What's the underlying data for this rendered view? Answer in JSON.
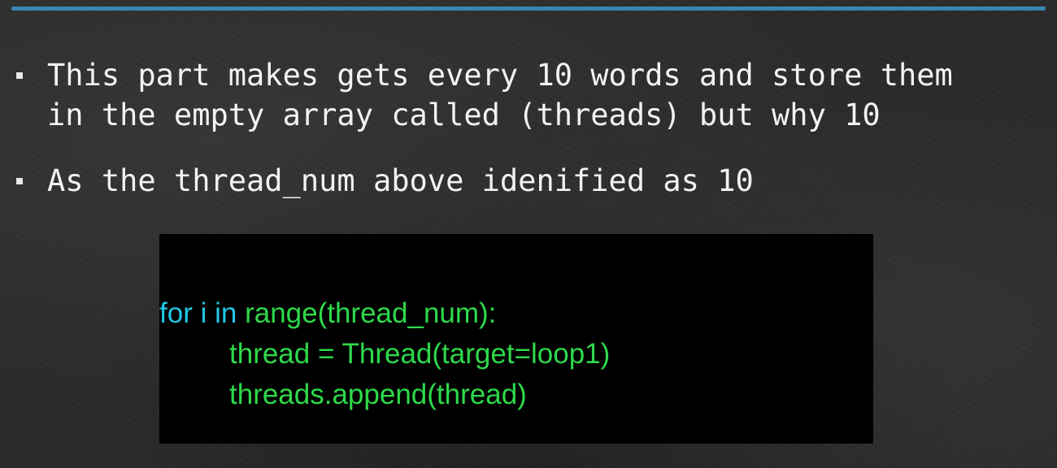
{
  "bullets": [
    {
      "lines": [
        "This part makes gets every 10 words and store them",
        "in the empty array called (threads) but why 10"
      ]
    },
    {
      "lines": [
        "As the thread_num above idenified as 10"
      ]
    }
  ],
  "code": {
    "line1": {
      "kw_for": "for",
      "var_i": " i ",
      "kw_in": "in",
      "rest": " range(thread_num):"
    },
    "line2": "thread = Thread(target=loop1)",
    "line3": "threads.append(thread)"
  },
  "colors": {
    "background": "#2b2b2b",
    "accent_rule": "#3a8fbf",
    "text": "#f2f2f2",
    "code_background": "#000000",
    "code_keyword": "#22c7e6",
    "code_text": "#2ed94a"
  }
}
